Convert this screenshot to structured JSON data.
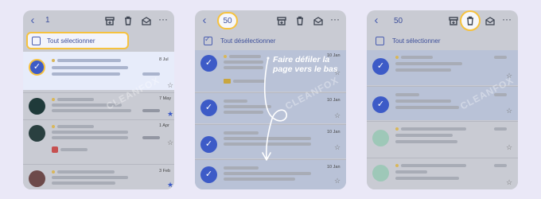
{
  "panel1": {
    "count": "1",
    "select_label": "Tout sélectionner",
    "rows": [
      {
        "date": "8 Jul"
      },
      {
        "date": "7 May"
      },
      {
        "date": "1 Apr"
      },
      {
        "date": "3 Feb"
      }
    ]
  },
  "panel2": {
    "count": "50",
    "select_label": "Tout désélectionner",
    "overlay": "Faire défiler la page vers le bas",
    "rows": [
      {
        "date": "10 Jan"
      },
      {
        "date": "10 Jan"
      },
      {
        "date": "10 Jan"
      },
      {
        "date": "10 Jan"
      }
    ]
  },
  "panel3": {
    "count": "50",
    "select_label": "Tout sélectionner"
  },
  "watermark": "CLEANFOX",
  "icons": {
    "back": "arrow-left-icon",
    "archive": "archive-icon",
    "trash": "trash-icon",
    "mail": "mail-icon",
    "more": "more-horizontal-icon",
    "star": "star-icon"
  },
  "colors": {
    "highlight": "#f6c23e",
    "accent": "#3d5bc7",
    "background": "#eae8f7"
  }
}
